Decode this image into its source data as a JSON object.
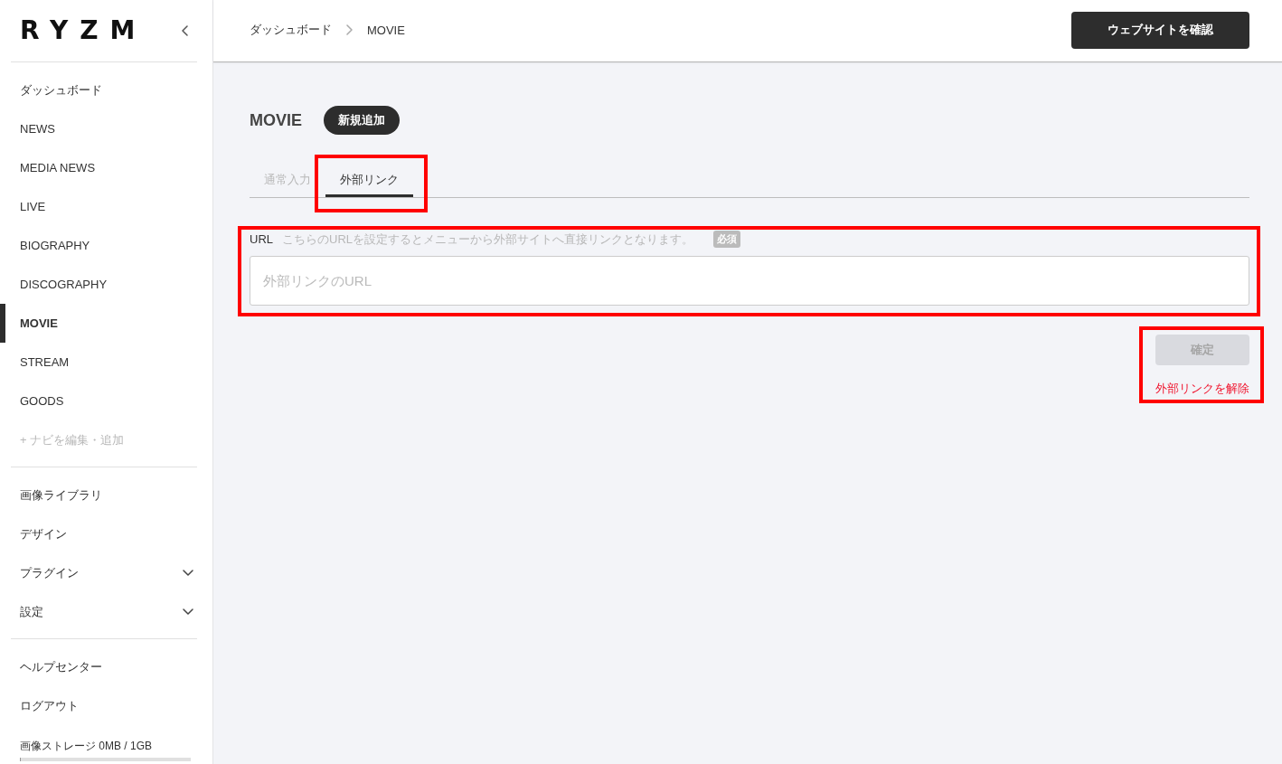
{
  "sidebar": {
    "logo": "RYZM",
    "nav_groups": [
      {
        "items": [
          {
            "label": "ダッシュボード",
            "kind": "page",
            "selected": false
          },
          {
            "label": "NEWS",
            "kind": "page",
            "selected": false
          },
          {
            "label": "MEDIA NEWS",
            "kind": "page",
            "selected": false
          },
          {
            "label": "LIVE",
            "kind": "page",
            "selected": false
          },
          {
            "label": "BIOGRAPHY",
            "kind": "page",
            "selected": false
          },
          {
            "label": "DISCOGRAPHY",
            "kind": "page",
            "selected": false
          },
          {
            "label": "MOVIE",
            "kind": "page",
            "selected": true
          },
          {
            "label": "STREAM",
            "kind": "page",
            "selected": false
          },
          {
            "label": "GOODS",
            "kind": "page",
            "selected": false
          },
          {
            "label": "+ ナビを編集・追加",
            "kind": "action",
            "selected": false
          }
        ]
      },
      {
        "items": [
          {
            "label": "画像ライブラリ",
            "kind": "page",
            "selected": false
          },
          {
            "label": "デザイン",
            "kind": "page",
            "selected": false
          },
          {
            "label": "プラグイン",
            "kind": "menu",
            "selected": false,
            "expanded": false
          },
          {
            "label": "設定",
            "kind": "menu",
            "selected": false,
            "expanded": false
          }
        ]
      },
      {
        "items": [
          {
            "label": "ヘルプセンター",
            "kind": "page",
            "selected": false
          },
          {
            "label": "ログアウト",
            "kind": "page",
            "selected": false
          }
        ]
      }
    ],
    "storage": {
      "label": "画像ストレージ 0MB / 1GB",
      "level": 0
    }
  },
  "header": {
    "breadcrumb": [
      "ダッシュボード",
      "MOVIE"
    ],
    "site_button": "ウェブサイトを確認"
  },
  "page": {
    "title": "MOVIE",
    "add_button": "新規追加"
  },
  "tabs": [
    {
      "label": "通常入力",
      "selected": false,
      "highlighted": false
    },
    {
      "label": "外部リンク",
      "selected": true,
      "highlighted": true
    }
  ],
  "url_field": {
    "label": "URL",
    "description": "こちらのURLを設定するとメニューから外部サイトへ直接リンクとなります。",
    "required_badge": "必須",
    "placeholder": "外部リンクのURL",
    "highlighted": true
  },
  "actions": {
    "confirm_button": {
      "label": "確定",
      "disabled": true
    },
    "unlink_link": "外部リンクを解除",
    "highlighted": true
  }
}
